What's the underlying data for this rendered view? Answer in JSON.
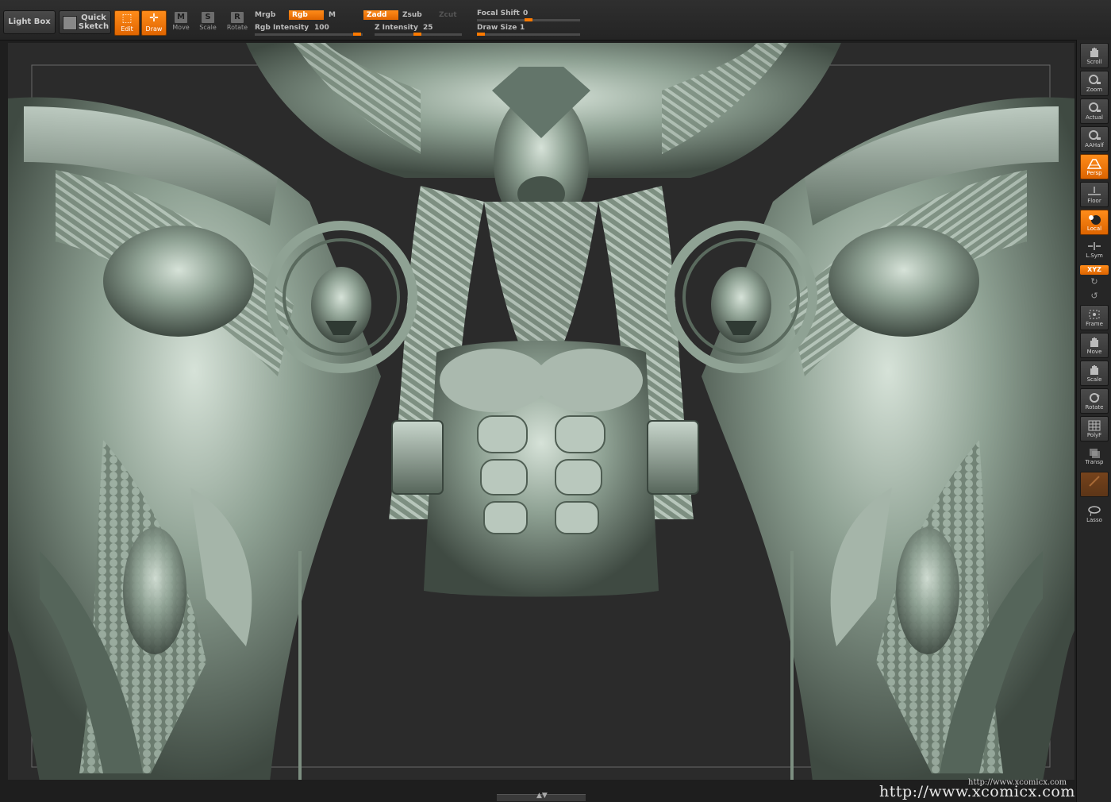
{
  "toolbar": {
    "light_box": "Light Box",
    "quick_sketch_line1": "Quick",
    "quick_sketch_line2": "Sketch",
    "edit": "Edit",
    "draw": "Draw",
    "move": "Move",
    "scale": "Scale",
    "rotate": "Rotate",
    "mrgb": "Mrgb",
    "rgb": "Rgb",
    "m": "M",
    "zadd": "Zadd",
    "zsub": "Zsub",
    "zcut": "Zcut",
    "rgb_intensity_label": "Rgb Intensity",
    "rgb_intensity_value": "100",
    "z_intensity_label": "Z Intensity",
    "z_intensity_value": "25",
    "focal_shift_label": "Focal Shift",
    "focal_shift_value": "0",
    "draw_size_label": "Draw Size",
    "draw_size_value": "1",
    "accent_color": "#ff7a00"
  },
  "shelf": {
    "scroll": "Scroll",
    "zoom": "Zoom",
    "actual": "Actual",
    "aahalf": "AAHalf",
    "persp": "Persp",
    "floor": "Floor",
    "local": "Local",
    "lsym": "L.Sym",
    "xyz": "XYZ",
    "frame": "Frame",
    "move": "Move",
    "scale": "Scale",
    "rotate": "Rotate",
    "polyf": "PolyF",
    "transp": "Transp",
    "lasso": "Lasso"
  },
  "canvas": {
    "model_color": "#8a9a8a",
    "background_color": "#2b2b2b"
  },
  "watermark": {
    "small": "http://www.xcomicx.com",
    "big": "http://www.xcomicx.com"
  }
}
